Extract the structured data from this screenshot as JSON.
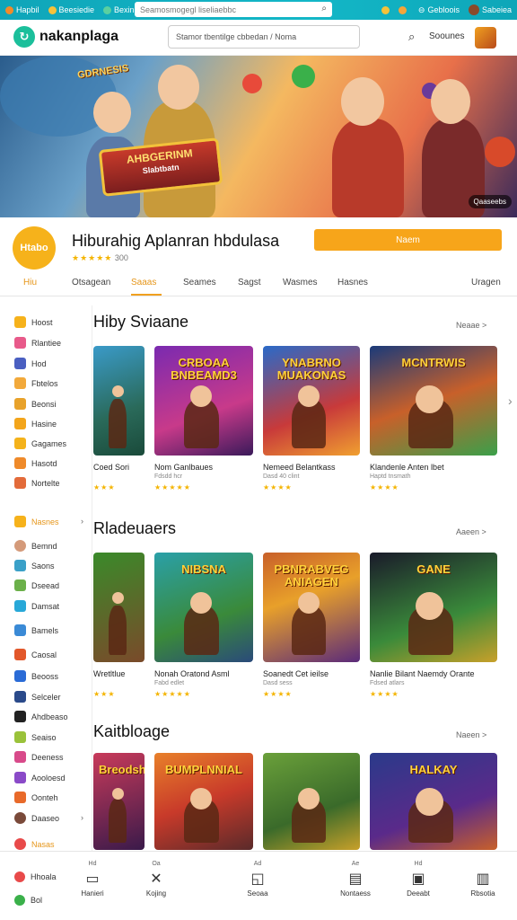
{
  "topbar": {
    "items": [
      "Hapbil",
      "Beesiedie",
      "Bexinisa"
    ],
    "search_placeholder": "Seamosmogegl liseliaebbc",
    "right_items": [
      "",
      "Gebloois",
      "Sabeiea"
    ]
  },
  "header": {
    "logo": "nakanplaga",
    "search_placeholder": "Stamor tbentilge cbbedan  /  Noma",
    "link": "Soounes"
  },
  "hero": {
    "tag": "GDRNESIS",
    "sign_text": "AHBGERINM",
    "sign_sub": "Slabtbatn",
    "badge": "Qaaseebs"
  },
  "app": {
    "icon_text": "Htabo",
    "title": "Hiburahig  Aplanran  hbdulasa",
    "rating_text": "300",
    "install_label": "Naem"
  },
  "tabs": [
    "Hiu",
    "Otsagean",
    "Saaas",
    "Seames",
    "Sagst",
    "Wasmes",
    "Hasnes",
    "Uragen"
  ],
  "sidebar": {
    "items": [
      {
        "label": "Hoost",
        "color": "#f6b21b"
      },
      {
        "label": "Rlantiee",
        "color": "#e85a8a"
      },
      {
        "label": "Hod",
        "color": "#4a5fc1"
      },
      {
        "label": "Fbtelos",
        "color": "#f2a93b"
      },
      {
        "label": "Beonsi",
        "color": "#e8a22b"
      },
      {
        "label": "Hasine",
        "color": "#f3a51b"
      },
      {
        "label": "Gagames",
        "color": "#f4b21b"
      },
      {
        "label": "Hasotd",
        "color": "#ef8a2a"
      },
      {
        "label": "Nortelte",
        "color": "#e36b3a"
      },
      {
        "label": "Nasnes",
        "color": "#f6b21b"
      },
      {
        "label": "Bemnd",
        "color": "#d49a7a"
      },
      {
        "label": "Saons",
        "color": "#3aa0c8"
      },
      {
        "label": "Dseead",
        "color": "#6bb04a"
      },
      {
        "label": "Damsat",
        "color": "#28a8d8"
      },
      {
        "label": "Bamels",
        "color": "#3a8ad6"
      },
      {
        "label": "Caosal",
        "color": "#e2572a"
      },
      {
        "label": "Beooss",
        "color": "#2a6bd6"
      },
      {
        "label": "Selceler",
        "color": "#2a4a8a"
      },
      {
        "label": "Ahdbeaso",
        "color": "#222222"
      },
      {
        "label": "Seaiso",
        "color": "#9ac23a"
      },
      {
        "label": "Deeness",
        "color": "#d84a8a"
      },
      {
        "label": "Aooloesd",
        "color": "#8a4ac8"
      },
      {
        "label": "Oonteh",
        "color": "#e86a2a"
      },
      {
        "label": "Daaseo",
        "color": "#7a4a3a"
      },
      {
        "label": "Nasas",
        "color": "#e84a4a"
      }
    ]
  },
  "sections": [
    {
      "title": "Hiby  Sviaane",
      "more": "Neaae  >",
      "cards": [
        {
          "text": "",
          "name": "Coed Sori",
          "sub": "",
          "stars": "★★★"
        },
        {
          "text": "CRBOAA  BNBEAMD3",
          "name": "Nom Ganlbaues",
          "sub": "Fdsdd  hcr",
          "stars": "★★★★★"
        },
        {
          "text": "YNABRNO MUAKONAS",
          "name": "Nemeed  Belantkass",
          "sub": "Dasd 40 clint",
          "stars": "★★★★"
        },
        {
          "text": "MCNTRWIS",
          "name": "Klandenle Anten lbet",
          "sub": "Haptd tnsmath",
          "stars": "★★★★"
        }
      ]
    },
    {
      "title": "Rladeuaers",
      "more": "Aaeen  >",
      "cards": [
        {
          "text": "",
          "name": "Wretltlue",
          "sub": "",
          "stars": "★★★"
        },
        {
          "text": "NIBSNA",
          "name": "Nonah Oratond Asml",
          "sub": "Fabd edlet",
          "stars": "★★★★★"
        },
        {
          "text": "PBNRABVEG ANIAGEN",
          "name": "Soanedt Cet ieilse",
          "sub": "Dasd sess",
          "stars": "★★★★"
        },
        {
          "text": "GANE",
          "name": "Nanlie Bilant Naemdy Orante",
          "sub": "Fdsed atlars",
          "stars": "★★★★"
        }
      ]
    },
    {
      "title": "Kaitbloage",
      "more": "Naeen  >",
      "cards": [
        {
          "text": "Breodshs",
          "name": "",
          "sub": "",
          "stars": ""
        },
        {
          "text": "BUMPLNNIAL",
          "name": "",
          "sub": "",
          "stars": ""
        },
        {
          "text": "",
          "name": "",
          "sub": "",
          "stars": ""
        },
        {
          "text": "HALKAY",
          "name": "",
          "sub": "",
          "stars": ""
        }
      ]
    }
  ],
  "bottom_nav": {
    "left_items": [
      "Hhoala",
      "Bol"
    ],
    "items": [
      {
        "top": "Hd",
        "icon": "▭",
        "label": "Hanieri"
      },
      {
        "top": "Oa",
        "icon": "✕",
        "label": "Kojing"
      },
      {
        "top": "Ad",
        "icon": "◱",
        "label": "Seoaa"
      },
      {
        "top": "Ae",
        "icon": "▤",
        "label": "Nontaess"
      },
      {
        "top": "Hd",
        "icon": "▣",
        "label": "Deeabt"
      },
      {
        "top": "",
        "icon": "▥",
        "label": "Rbsotia"
      }
    ]
  },
  "colors": {
    "accent": "#f7a51a",
    "topbar": "#13b7c7",
    "brand": "#1bbf9b"
  }
}
